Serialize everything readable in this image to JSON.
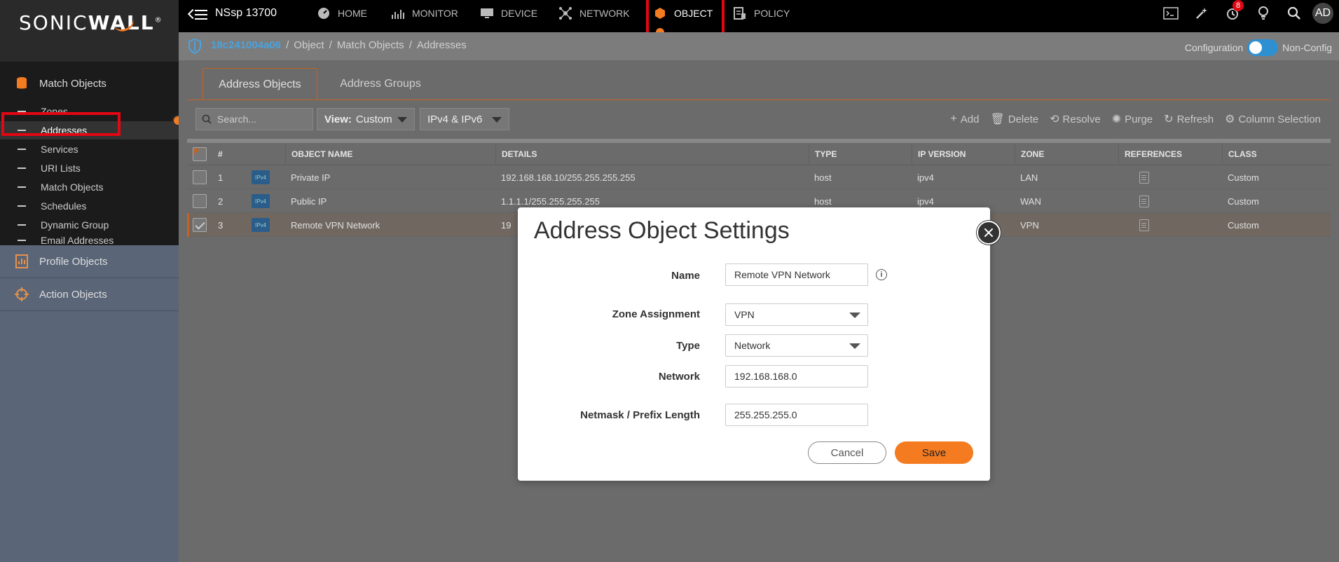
{
  "brand": {
    "logo_text_a": "SONIC",
    "logo_text_b": "WALL",
    "reg": "®"
  },
  "header": {
    "device_name": "NSsp 13700",
    "nav": [
      {
        "label": "HOME",
        "icon": "gauge-icon"
      },
      {
        "label": "MONITOR",
        "icon": "chart-icon"
      },
      {
        "label": "DEVICE",
        "icon": "monitor-icon"
      },
      {
        "label": "NETWORK",
        "icon": "network-icon"
      },
      {
        "label": "OBJECT",
        "icon": "object-icon"
      },
      {
        "label": "POLICY",
        "icon": "policy-icon"
      }
    ],
    "notification_count": "8",
    "avatar_initials": "AD"
  },
  "breadcrumb": {
    "items": [
      "18c241004a06",
      "Object",
      "Match Objects",
      "Addresses"
    ],
    "config_label": "Configuration",
    "nonconfig_label": "Non-Config"
  },
  "sidebar": {
    "match_objects": "Match Objects",
    "items": [
      "Zones",
      "Addresses",
      "Services",
      "URI Lists",
      "Match Objects",
      "Schedules",
      "Dynamic Group",
      "Email Addresses"
    ],
    "profile_objects": "Profile Objects",
    "action_objects": "Action Objects"
  },
  "tabs": [
    "Address Objects",
    "Address Groups"
  ],
  "toolbar": {
    "search_placeholder": "Search...",
    "view_label": "View:",
    "view_value": "Custom",
    "ip_filter": "IPv4 & IPv6",
    "actions": [
      "Add",
      "Delete",
      "Resolve",
      "Purge",
      "Refresh",
      "Column Selection"
    ]
  },
  "table": {
    "headers": [
      "#",
      "OBJECT NAME",
      "DETAILS",
      "TYPE",
      "IP VERSION",
      "ZONE",
      "REFERENCES",
      "CLASS"
    ],
    "rows": [
      {
        "num": "1",
        "badge": "IPv4",
        "name": "Private IP",
        "details": "192.168.168.10/255.255.255.255",
        "type": "host",
        "ipver": "ipv4",
        "zone": "LAN",
        "class": "Custom"
      },
      {
        "num": "2",
        "badge": "IPv4",
        "name": "Public IP",
        "details": "1.1.1.1/255.255.255.255",
        "type": "host",
        "ipver": "ipv4",
        "zone": "WAN",
        "class": "Custom"
      },
      {
        "num": "3",
        "badge": "IPv4",
        "name": "Remote VPN Network",
        "details": "19",
        "type": "",
        "ipver": "",
        "zone": "VPN",
        "class": "Custom"
      }
    ]
  },
  "modal": {
    "title": "Address Object Settings",
    "name_label": "Name",
    "name_value": "Remote VPN Network",
    "zone_label": "Zone Assignment",
    "zone_value": "VPN",
    "type_label": "Type",
    "type_value": "Network",
    "network_label": "Network",
    "network_value": "192.168.168.0",
    "netmask_label": "Netmask / Prefix Length",
    "netmask_value": "255.255.255.0",
    "cancel_label": "Cancel",
    "save_label": "Save"
  },
  "colors": {
    "accent": "#f47b20",
    "highlight": "#e30613",
    "link": "#4aa3df"
  }
}
